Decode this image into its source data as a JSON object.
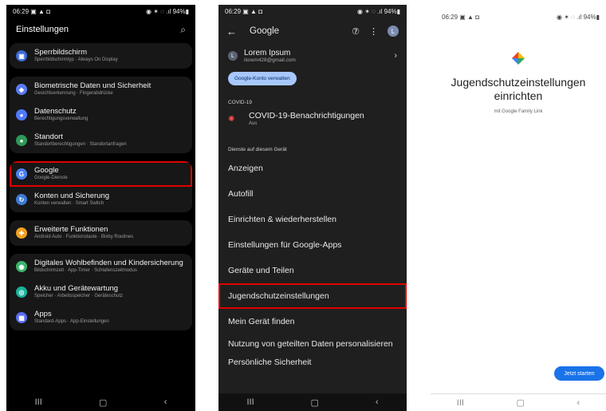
{
  "panel1": {
    "status": {
      "time": "06:29",
      "left_icons": "▣ ▲ ◘",
      "right_icons": "◉ ✶ ◌ .ıl 94%▮"
    },
    "title": "Einstellungen",
    "items": [
      {
        "label": "Sperrbildschirm",
        "sub": "Sperrbildschirmtyp · Always On Display",
        "color": "#3d6bd6",
        "icon": "lock-icon"
      },
      {
        "label": "Biometrische Daten und Sicherheit",
        "sub": "Gesichtserkennung · Fingerabdrücke",
        "color": "#5a7bf5",
        "icon": "shield-icon"
      },
      {
        "label": "Datenschutz",
        "sub": "Berechtigungsverwaltung",
        "color": "#4f79ff",
        "icon": "privacy-icon"
      },
      {
        "label": "Standort",
        "sub": "Standortberechtigungen · Standortanfragen",
        "color": "#2e9a59",
        "icon": "location-icon"
      },
      {
        "label": "Google",
        "sub": "Google-Dienste",
        "color": "#4a80f0",
        "icon": "google-icon"
      },
      {
        "label": "Konten und Sicherung",
        "sub": "Konten verwalten · Smart Switch",
        "color": "#3d7bd6",
        "icon": "sync-icon"
      },
      {
        "label": "Erweiterte Funktionen",
        "sub": "Android Auto · Funktionstaste · Bixby Routines",
        "color": "#f0a020",
        "icon": "advanced-icon"
      },
      {
        "label": "Digitales Wohlbefinden und Kindersicherung",
        "sub": "Bildschirmzeit · App-Timer · Schlafenszeitmodus",
        "color": "#3bb56b",
        "icon": "wellbeing-icon"
      },
      {
        "label": "Akku und Gerätewartung",
        "sub": "Speicher · Arbeitsspeicher · Geräteschutz",
        "color": "#18b39a",
        "icon": "battery-icon"
      },
      {
        "label": "Apps",
        "sub": "Standard-Apps · App-Einstellungen",
        "color": "#5a6cf0",
        "icon": "apps-icon"
      }
    ],
    "nav": {
      "recent": "III",
      "home": "▢",
      "back": "‹"
    }
  },
  "panel2": {
    "status": {
      "time": "06:29",
      "left_icons": "▣ ▲ ◘",
      "right_icons": "◉ ✶ ◌ .ıl 94%▮"
    },
    "title": "Google",
    "help": "⑦",
    "more": "⋮",
    "avatar": "L",
    "account": {
      "name": "Lorem Ipsum",
      "email": "ilorem428@gmail.com",
      "initial": "L"
    },
    "manage_label": "Google-Konto verwalten",
    "section_covid": "COVID-19",
    "covid_title": "COVID-19-Benachrichtigungen",
    "covid_sub": "Aus",
    "section_services": "Dienste auf diesem Gerät",
    "items": [
      "Anzeigen",
      "Autofill",
      "Einrichten & wiederherstellen",
      "Einstellungen für Google-Apps",
      "Geräte und Teilen",
      "Jugendschutzeinstellungen",
      "Mein Gerät finden"
    ],
    "item_personalize": "Nutzung von geteilten Daten personalisieren",
    "item_safety": "Persönliche Sicherheit",
    "nav": {
      "recent": "III",
      "home": "▢",
      "back": "‹"
    }
  },
  "panel3": {
    "status": {
      "time": "06:29",
      "left_icons": "▣ ▲ ◘",
      "right_icons": "◉ ✶ ◌ .ıl 94%▮"
    },
    "title": "Jugendschutzeinstellungen einrichten",
    "subtitle": "mit Google Family Link",
    "button": "Jetzt starten",
    "nav": {
      "recent": "III",
      "home": "▢",
      "back": "‹"
    }
  }
}
